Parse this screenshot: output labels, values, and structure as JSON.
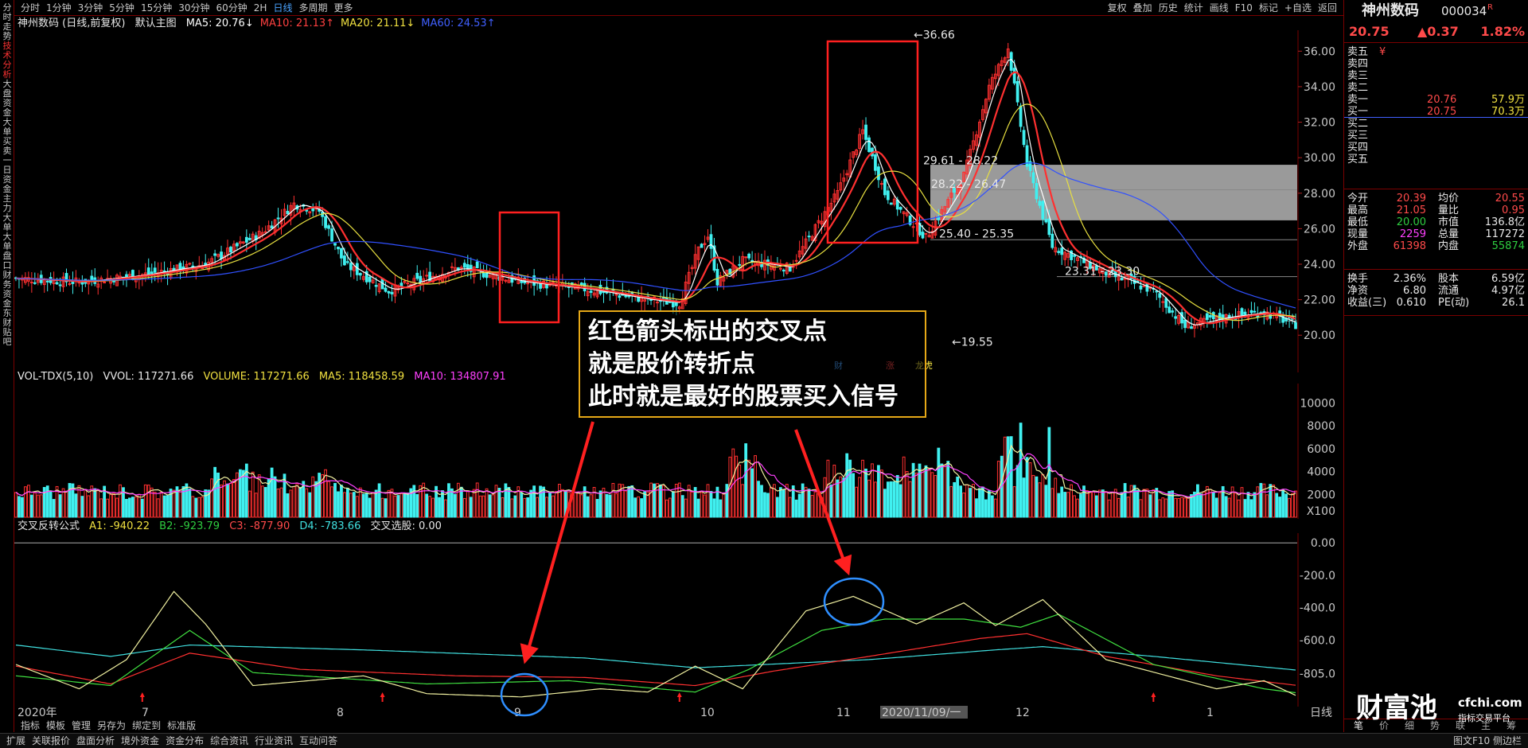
{
  "left_tabs": [
    "分时走势",
    "技术分析",
    "大盘资金",
    "大单买卖",
    "一日资金",
    "主力大单",
    "大单盘口",
    "财务资金",
    "东财贴吧"
  ],
  "toolbar": {
    "periods": [
      "分时",
      "1分钟",
      "3分钟",
      "5分钟",
      "15分钟",
      "30分钟",
      "60分钟",
      "2H",
      "日线",
      "多周期",
      "更多"
    ],
    "selected": "日线",
    "right": [
      "复权",
      "叠加",
      "历史",
      "统计",
      "画线",
      "F10",
      "标记",
      "+自选",
      "返回"
    ]
  },
  "main_chart": {
    "stock_title": "神州数码 (日线,前复权)",
    "main_label": "默认主图",
    "ma": [
      {
        "name": "MA5",
        "value": "20.76",
        "color": "#ffffff"
      },
      {
        "name": "MA10",
        "value": "21.13",
        "color": "#ff4040"
      },
      {
        "name": "MA20",
        "value": "21.11",
        "color": "#f0e040"
      },
      {
        "name": "MA60",
        "value": "24.53",
        "color": "#4060ff"
      }
    ],
    "y_ticks": [
      "36.00",
      "34.00",
      "32.00",
      "30.00",
      "28.00",
      "26.00",
      "24.00",
      "22.00",
      "20.00"
    ],
    "annotations": [
      "36.66",
      "29.61 - 28.22",
      "28.22 - 26.47",
      "25.40 - 25.35",
      "23.31 - 23.30",
      "19.55"
    ],
    "event_marks": [
      "财",
      "涨",
      "龙虎"
    ]
  },
  "volume_chart": {
    "title": "VOL-TDX(5,10)",
    "vvol": "VVOL: 117271.66",
    "volume": "VOLUME: 117271.66",
    "ma5": "MA5: 118458.59",
    "ma10": "MA10: 134807.91",
    "y_ticks": [
      "10000",
      "8000",
      "6000",
      "4000",
      "2000",
      "X100"
    ]
  },
  "indicator_chart": {
    "title": "交叉反转公式",
    "a1": "A1: -940.22",
    "b2": "B2: -923.79",
    "c3": "C3: -877.90",
    "d4": "D4: -783.66",
    "select": "交叉选股: 0.00",
    "y_ticks": [
      "0.00",
      "-200.0",
      "-400.0",
      "-600.0",
      "-805.0"
    ]
  },
  "x_axis": {
    "labels": [
      "2020年",
      "7",
      "8",
      "9",
      "10",
      "11",
      "2020/11/09/一",
      "12",
      "1"
    ],
    "period": "日线"
  },
  "annotation_text": [
    "红色箭头标出的交叉点",
    "就是股价转折点",
    "此时就是最好的股票买入信号"
  ],
  "quote": {
    "name": "神州数码",
    "code": "000034",
    "badge": "R",
    "price": "20.75",
    "change": "▲0.37",
    "pct": "1.82%",
    "order_book": [
      {
        "label": "卖五",
        "price": "¥",
        "vol": ""
      },
      {
        "label": "卖四",
        "price": "",
        "vol": ""
      },
      {
        "label": "卖三",
        "price": "",
        "vol": ""
      },
      {
        "label": "卖二",
        "price": "",
        "vol": ""
      },
      {
        "label": "卖一",
        "price": "20.76",
        "vol": "57.9万"
      },
      {
        "label": "买一",
        "price": "20.75",
        "vol": "70.3万"
      },
      {
        "label": "买二",
        "price": "",
        "vol": ""
      },
      {
        "label": "买三",
        "price": "",
        "vol": ""
      },
      {
        "label": "买四",
        "price": "",
        "vol": ""
      },
      {
        "label": "买五",
        "price": "",
        "vol": ""
      }
    ],
    "stats": [
      {
        "l1": "今开",
        "v1": "20.39",
        "l2": "均价",
        "v2": "20.55"
      },
      {
        "l1": "最高",
        "v1": "21.05",
        "l2": "量比",
        "v2": "0.95"
      },
      {
        "l1": "最低",
        "v1": "20.00",
        "l2": "市值",
        "v2": "136.8亿"
      },
      {
        "l1": "现量",
        "v1": "2259",
        "l2": "总量",
        "v2": "117272"
      },
      {
        "l1": "外盘",
        "v1": "61398",
        "l2": "内盘",
        "v2": "55874"
      }
    ],
    "stats2": [
      {
        "l1": "换手",
        "v1": "2.36%",
        "l2": "股本",
        "v2": "6.59亿"
      },
      {
        "l1": "净资",
        "v1": "6.80",
        "l2": "流通",
        "v2": "4.97亿"
      },
      {
        "l1": "收益(三)",
        "v1": "0.610",
        "l2": "PE(动)",
        "v2": "26.1"
      }
    ],
    "bottom_tabs": [
      "笔",
      "价",
      "细",
      "势",
      "联",
      "主",
      "筹"
    ]
  },
  "bottom_tabs": [
    "指标",
    "模板",
    "管理",
    "另存为",
    "绑定到",
    "标准版"
  ],
  "statusbar": {
    "left": [
      "扩展",
      "关联报价",
      "盘面分析",
      "境外资金",
      "资金分布",
      "综合资讯",
      "行业资讯",
      "互动问答"
    ],
    "right": "图文F10 侧边栏"
  },
  "watermark": {
    "brand": "财富池",
    "site": "cfchi.com",
    "sub": "指标交易平台"
  }
}
